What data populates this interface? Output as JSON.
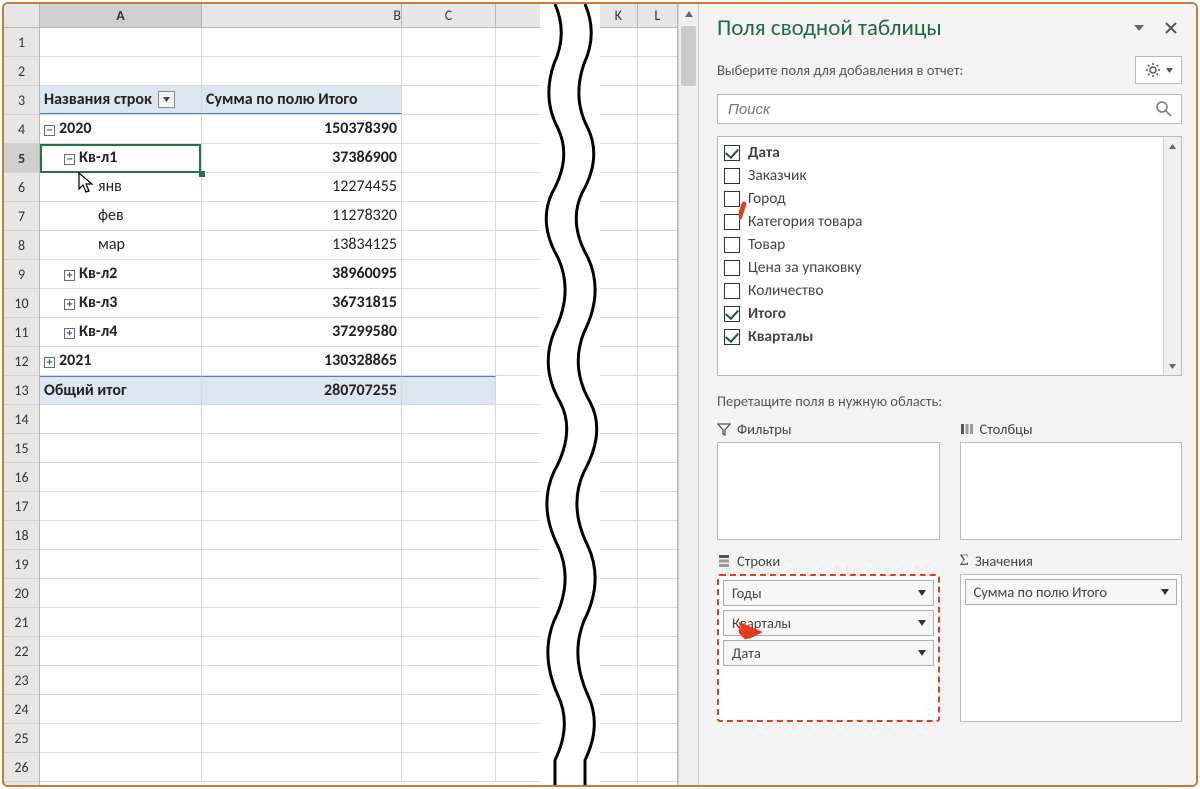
{
  "columns": [
    "A",
    "B",
    "C",
    "K",
    "L"
  ],
  "selectedColumn": "A",
  "selectedRow": 5,
  "rowCount": 26,
  "pivot": {
    "headerA": "Названия строк",
    "headerB": "Сумма по полю Итого",
    "rows": [
      {
        "indent": 1,
        "toggle": "-",
        "label": "2020",
        "val": "150378390",
        "bold": true
      },
      {
        "indent": 2,
        "toggle": "-",
        "label": "Кв-л1",
        "val": "37386900",
        "bold": true,
        "active": true
      },
      {
        "indent": 3,
        "toggle": "",
        "label": "янв",
        "val": "12274455"
      },
      {
        "indent": 3,
        "toggle": "",
        "label": "фев",
        "val": "11278320"
      },
      {
        "indent": 3,
        "toggle": "",
        "label": "мар",
        "val": "13834125"
      },
      {
        "indent": 2,
        "toggle": "+",
        "label": "Кв-л2",
        "val": "38960095",
        "bold": true
      },
      {
        "indent": 2,
        "toggle": "+",
        "label": "Кв-л3",
        "val": "36731815",
        "bold": true
      },
      {
        "indent": 2,
        "toggle": "+",
        "label": "Кв-л4",
        "val": "37299580",
        "bold": true
      },
      {
        "indent": 1,
        "toggle": "+",
        "label": "2021",
        "val": "130328865",
        "bold": true
      }
    ],
    "totalLabel": "Общий итог",
    "totalVal": "280707255"
  },
  "pane": {
    "title": "Поля сводной таблицы",
    "subtitle": "Выберите поля для добавления в отчет:",
    "searchPlaceholder": "Поиск",
    "fields": [
      {
        "label": "Дата",
        "checked": true,
        "bold": true
      },
      {
        "label": "Заказчик",
        "checked": false
      },
      {
        "label": "Город",
        "checked": false
      },
      {
        "label": "Категория товара",
        "checked": false
      },
      {
        "label": "Товар",
        "checked": false
      },
      {
        "label": "Цена за упаковку",
        "checked": false
      },
      {
        "label": "Количество",
        "checked": false
      },
      {
        "label": "Итого",
        "checked": true,
        "bold": true
      },
      {
        "label": "Кварталы",
        "checked": true,
        "bold": true
      }
    ],
    "dragHint": "Перетащите поля в нужную область:",
    "areas": {
      "filters": "Фильтры",
      "columns": "Столбцы",
      "rows": "Строки",
      "values": "Значения"
    },
    "rowItems": [
      "Годы",
      "Кварталы",
      "Дата"
    ],
    "valueItems": [
      "Сумма по полю Итого"
    ]
  }
}
